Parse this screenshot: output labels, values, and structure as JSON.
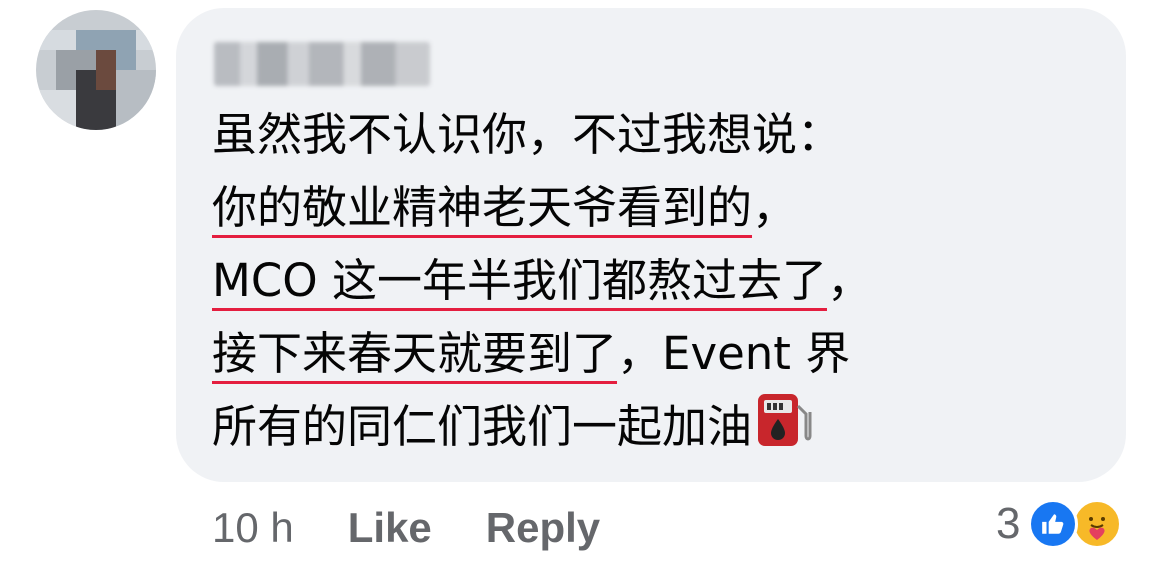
{
  "comment": {
    "lines": [
      "虽然我不认识你，不过我想说：",
      "你的敬业精神老天爷看到的",
      "，",
      "MCO 这一年半我们都熬过去了",
      "，",
      "接下来春天就要到了",
      "，Event 界",
      "所有的同仁们我们一起加油"
    ],
    "emoji": "fuel-pump-icon"
  },
  "footer": {
    "time": "10 h",
    "like_label": "Like",
    "reply_label": "Reply",
    "reaction_count": "3",
    "reactions": [
      "like-icon",
      "care-icon"
    ]
  },
  "colors": {
    "bubble": "#f0f2f5",
    "text": "#050505",
    "muted": "#65676b",
    "underline": "#e41e3f",
    "like_blue": "#1877f2",
    "care_yellow": "#f7b928"
  }
}
